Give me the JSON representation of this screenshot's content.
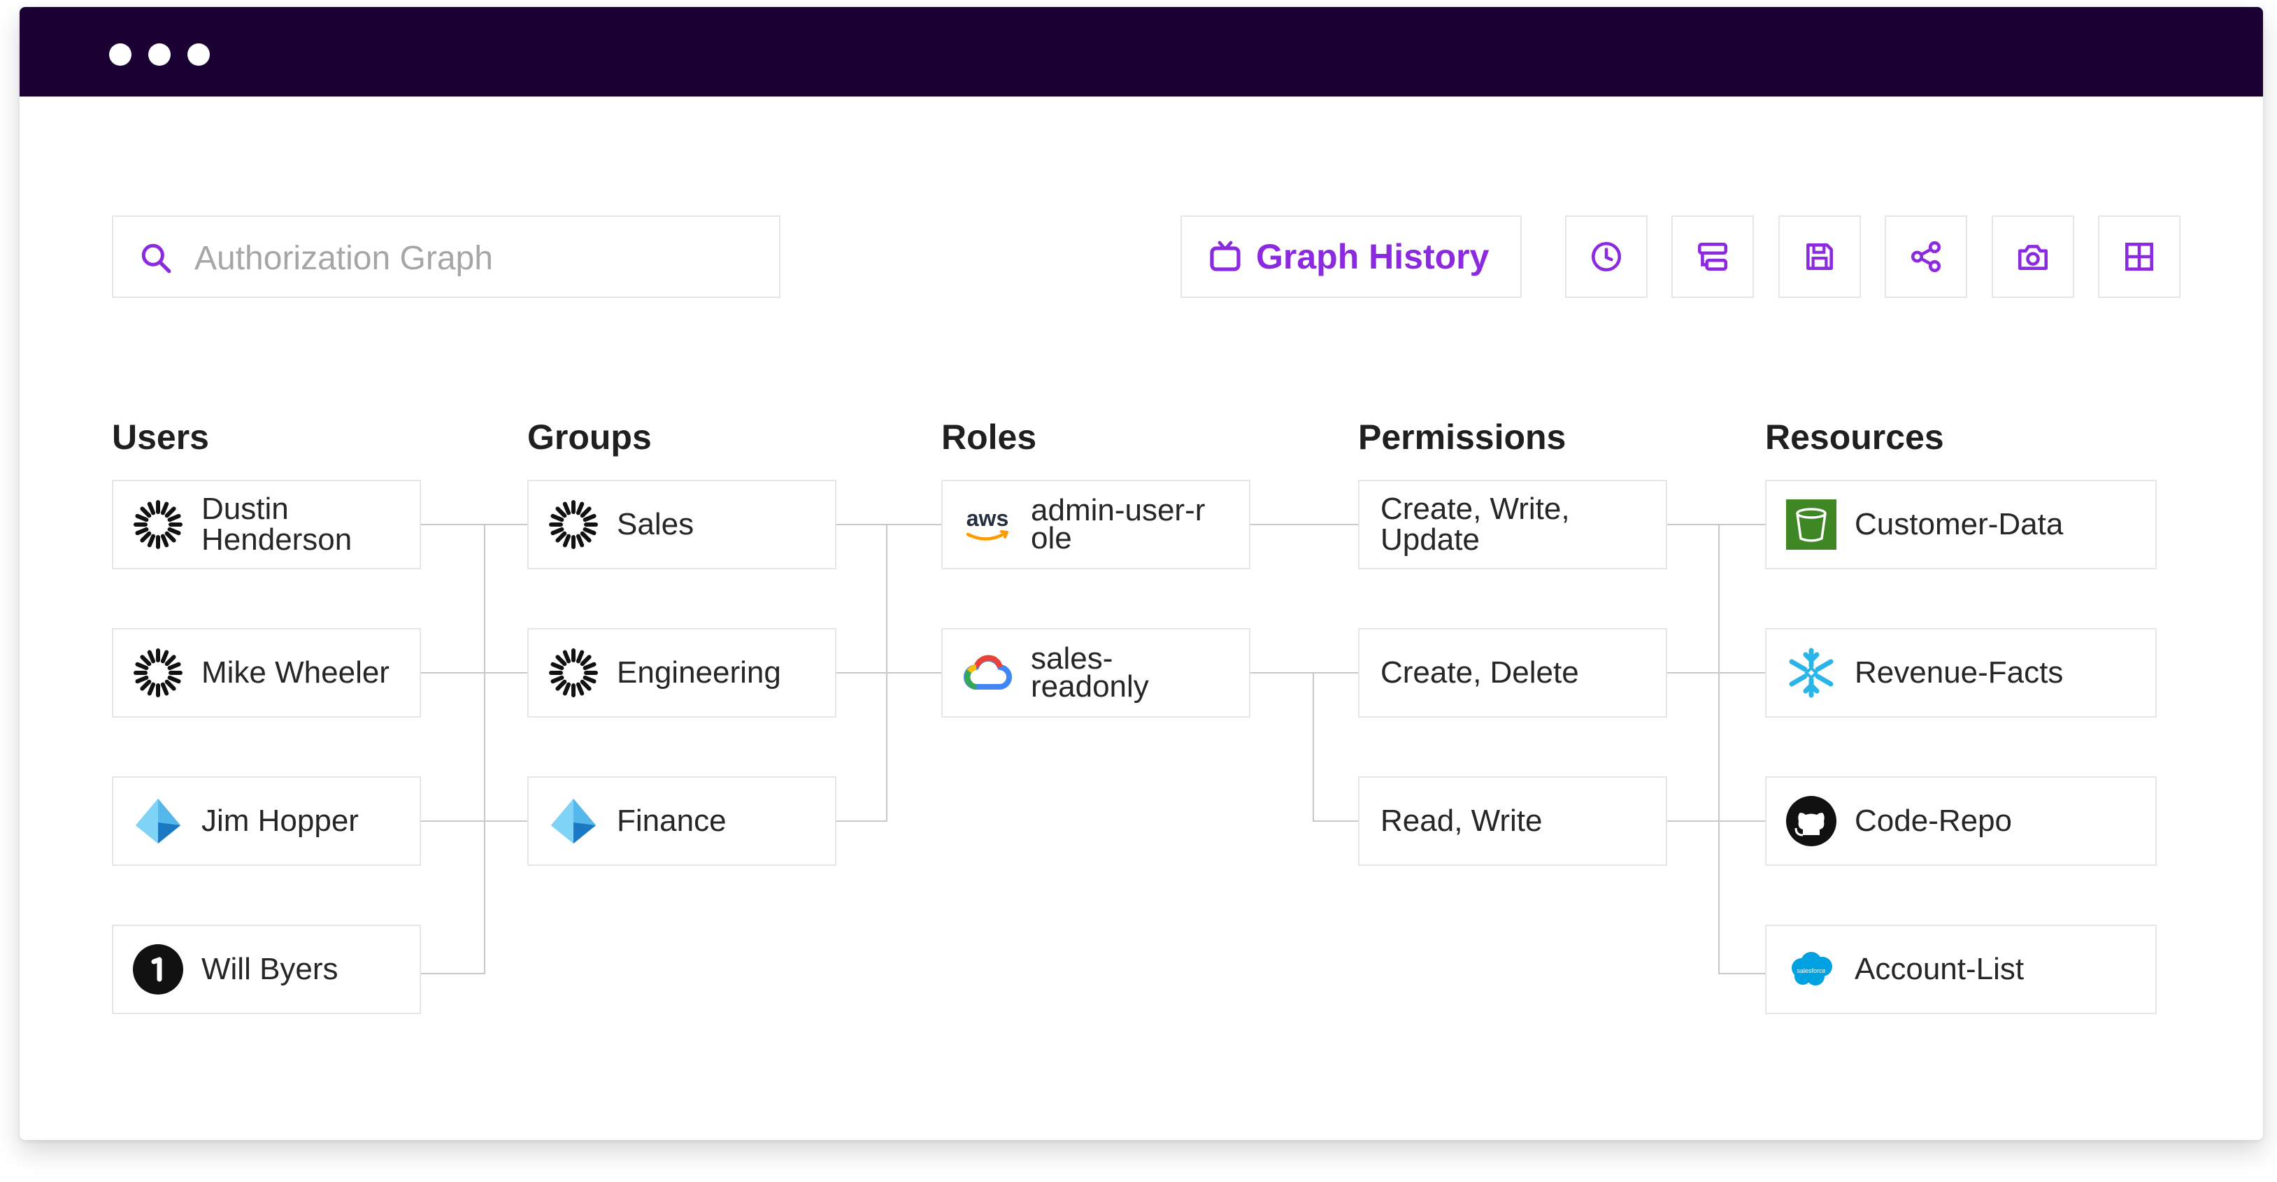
{
  "search": {
    "placeholder": "Authorization Graph"
  },
  "toolbar": {
    "history_label": "Graph History",
    "buttons": [
      {
        "icon": "clock-icon"
      },
      {
        "icon": "filter-icon"
      },
      {
        "icon": "save-icon"
      },
      {
        "icon": "share-icon"
      },
      {
        "icon": "camera-icon"
      },
      {
        "icon": "grid-layout-icon"
      }
    ],
    "accent_color": "#8c2ae0"
  },
  "columns": {
    "users": {
      "title": "Users",
      "items": [
        {
          "label": "Dustin Henderson",
          "icon": "sunburst-logo-icon"
        },
        {
          "label": "Mike Wheeler",
          "icon": "sunburst-logo-icon"
        },
        {
          "label": "Jim Hopper",
          "icon": "azure-pyramid-icon"
        },
        {
          "label": "Will Byers",
          "icon": "onepassword-icon"
        }
      ]
    },
    "groups": {
      "title": "Groups",
      "items": [
        {
          "label": "Sales",
          "icon": "sunburst-logo-icon"
        },
        {
          "label": "Engineering",
          "icon": "sunburst-logo-icon"
        },
        {
          "label": "Finance",
          "icon": "azure-pyramid-icon"
        }
      ]
    },
    "roles": {
      "title": "Roles",
      "items": [
        {
          "label": "admin-user-role",
          "icon": "aws-icon",
          "logo_text": "aws"
        },
        {
          "label": "sales-readonly",
          "icon": "google-cloud-icon"
        }
      ]
    },
    "permissions": {
      "title": "Permissions",
      "items": [
        {
          "label": "Create, Write, Update"
        },
        {
          "label": "Create, Delete"
        },
        {
          "label": "Read, Write"
        }
      ]
    },
    "resources": {
      "title": "Resources",
      "items": [
        {
          "label": "Customer-Data",
          "icon": "s3-bucket-icon"
        },
        {
          "label": "Revenue-Facts",
          "icon": "snowflake-icon"
        },
        {
          "label": "Code-Repo",
          "icon": "github-icon"
        },
        {
          "label": "Account-List",
          "icon": "salesforce-icon",
          "logo_text": "salesforce"
        }
      ]
    }
  },
  "colors": {
    "titlebar": "#1a0033",
    "border": "#e6e6e6",
    "connector": "#c8c8c8"
  }
}
